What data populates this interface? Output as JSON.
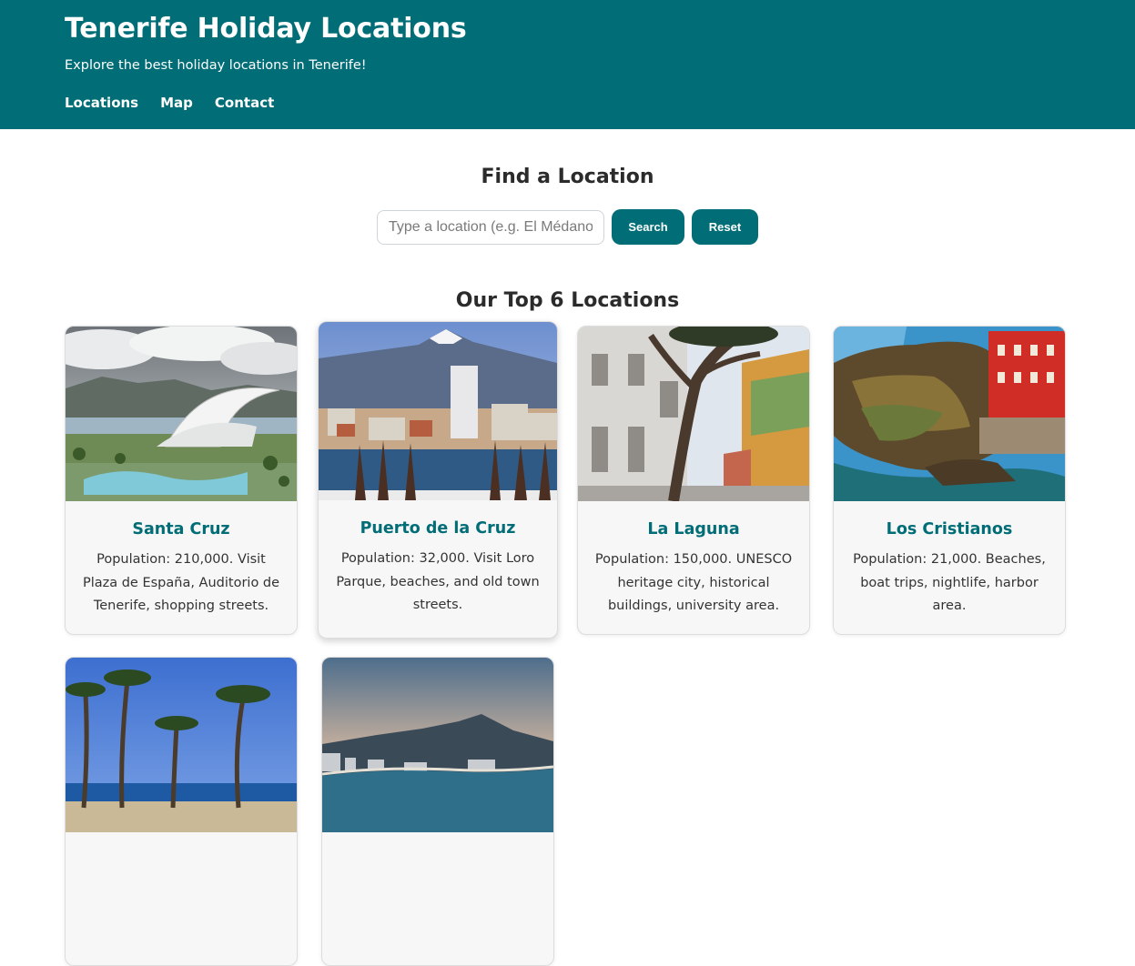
{
  "header": {
    "title": "Tenerife Holiday Locations",
    "tagline": "Explore the best holiday locations in Tenerife!",
    "nav": [
      "Locations",
      "Map",
      "Contact"
    ]
  },
  "search": {
    "title": "Find a Location",
    "placeholder": "Type a location (e.g. El Médano)",
    "search_label": "Search",
    "reset_label": "Reset"
  },
  "locations": {
    "title": "Our Top 6 Locations",
    "cards": [
      {
        "name": "Santa Cruz",
        "description": "Population: 210,000. Visit Plaza de España, Auditorio de Tenerife, shopping streets.",
        "image": "santa-cruz-auditorium-photo"
      },
      {
        "name": "Puerto de la Cruz",
        "description": "Population: 32,000. Visit Loro Parque, beaches, and old town streets.",
        "image": "puerto-de-la-cruz-teide-photo"
      },
      {
        "name": "La Laguna",
        "description": "Population: 150,000. UNESCO heritage city, historical buildings, university area.",
        "image": "la-laguna-street-tree-photo"
      },
      {
        "name": "Los Cristianos",
        "description": "Population: 21,000. Beaches, boat trips, nightlife, harbor area.",
        "image": "los-cristianos-cliff-houses-photo"
      },
      {
        "name": "",
        "description": "",
        "image": "palm-trees-beach-photo"
      },
      {
        "name": "",
        "description": "",
        "image": "coastal-city-mountain-photo"
      }
    ]
  },
  "colors": {
    "primary": "#006d77",
    "card_background": "#f7f7f7",
    "text": "#2b2b2b"
  }
}
